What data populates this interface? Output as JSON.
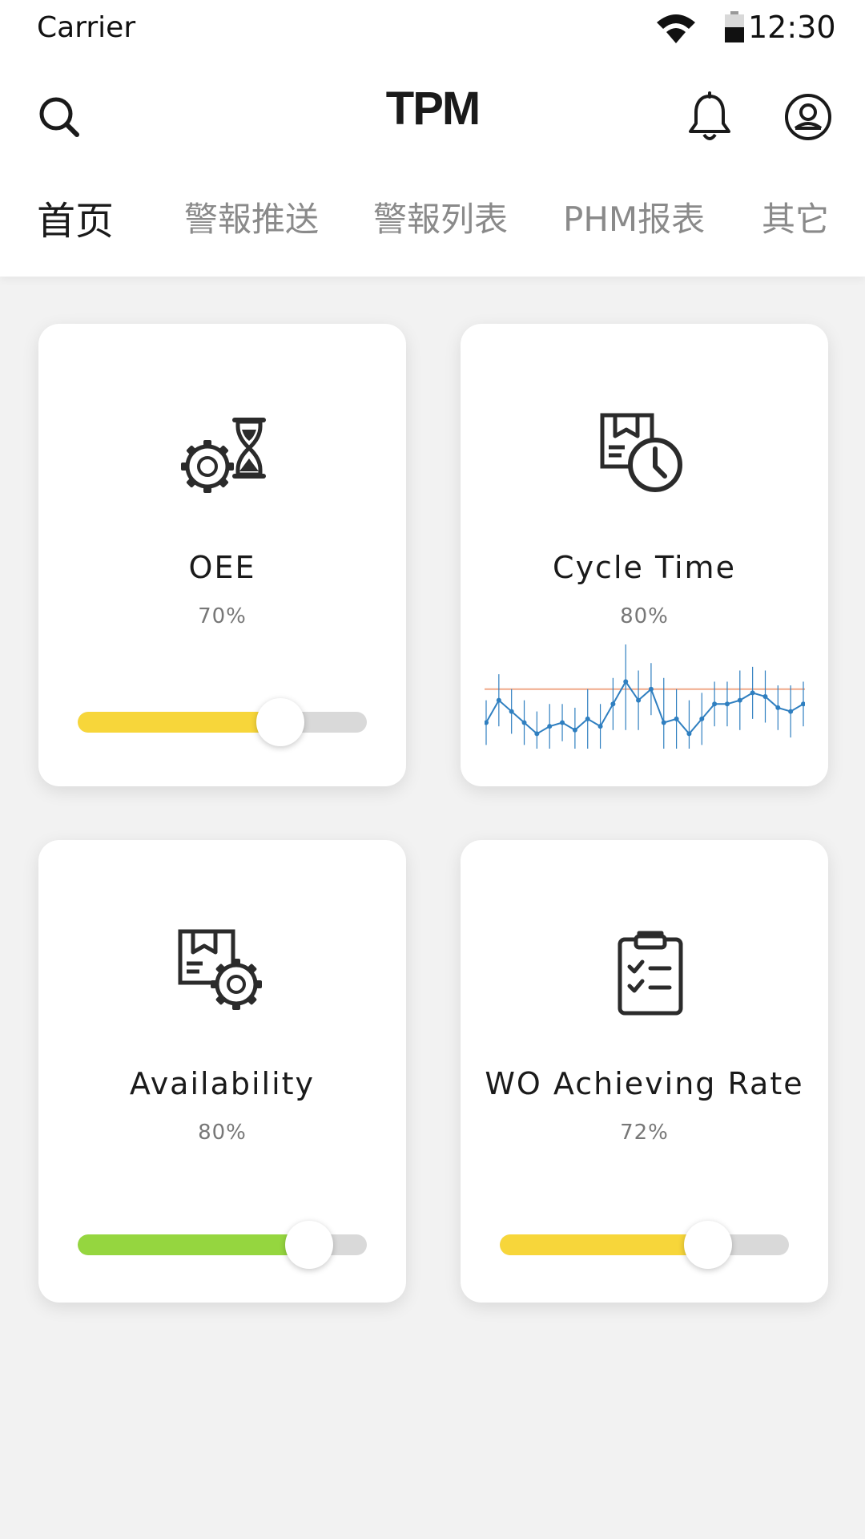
{
  "status_bar": {
    "carrier": "Carrier",
    "time": "12:30"
  },
  "app_bar": {
    "title": "TPM"
  },
  "tabs": [
    {
      "label": "首页",
      "active": true
    },
    {
      "label": "警報推送",
      "active": false
    },
    {
      "label": "警報列表",
      "active": false
    },
    {
      "label": "PHM报表",
      "active": false
    },
    {
      "label": "其它",
      "active": false
    }
  ],
  "cards": [
    {
      "title": "OEE",
      "value": "70%",
      "progress": 0.7,
      "color": "#f7d63a",
      "icon": "gear-hourglass-icon"
    },
    {
      "title": "Cycle Time",
      "value": "80%",
      "icon": "document-clock-icon"
    },
    {
      "title": "Availability",
      "value": "80%",
      "progress": 0.8,
      "color": "#95d63f",
      "icon": "document-gear-icon"
    },
    {
      "title": "WO Achieving Rate",
      "value": "72%",
      "progress": 0.72,
      "color": "#f7d63a",
      "icon": "clipboard-checklist-icon"
    }
  ],
  "cycle_time_chart": {
    "type": "line",
    "line_color": "#2f7fc0",
    "reference_color": "#f0a98a",
    "reference": 0.0,
    "values": [
      -0.9,
      -0.3,
      -0.6,
      -0.9,
      -1.2,
      -1.0,
      -0.9,
      -1.1,
      -0.8,
      -1.0,
      -0.4,
      0.2,
      -0.3,
      0.0,
      -0.9,
      -0.8,
      -1.2,
      -0.8,
      -0.4,
      -0.4,
      -0.3,
      -0.1,
      -0.2,
      -0.5,
      -0.6,
      -0.4
    ],
    "errors": [
      0.6,
      0.7,
      0.6,
      0.6,
      0.6,
      0.6,
      0.5,
      0.6,
      0.8,
      0.6,
      0.7,
      1.3,
      0.8,
      0.7,
      1.2,
      0.8,
      0.9,
      0.7,
      0.6,
      0.6,
      0.8,
      0.7,
      0.7,
      0.6,
      0.7,
      0.6
    ]
  }
}
